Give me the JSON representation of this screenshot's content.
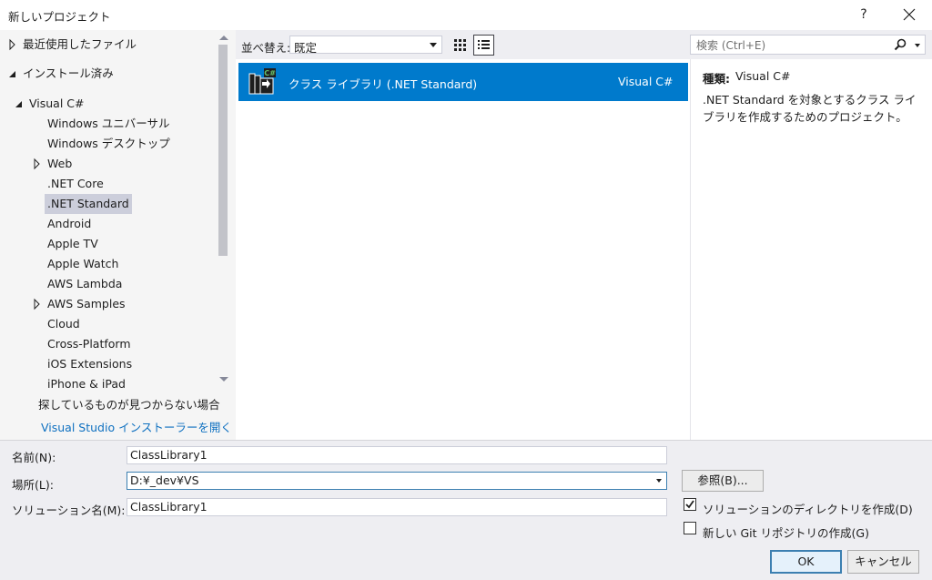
{
  "window": {
    "title": "新しいプロジェクト",
    "help_label": "?"
  },
  "tree": {
    "items": [
      {
        "label": "最近使用したファイル",
        "arrow": "right"
      },
      {
        "label": "インストール済み",
        "arrow": "down"
      },
      {
        "label": "Visual C#",
        "arrow": "down"
      },
      {
        "label": "Windows ユニバーサル",
        "arrow": ""
      },
      {
        "label": "Windows デスクトップ",
        "arrow": ""
      },
      {
        "label": "Web",
        "arrow": "right"
      },
      {
        "label": ".NET Core",
        "arrow": ""
      },
      {
        "label": ".NET Standard",
        "arrow": "",
        "selected": true
      },
      {
        "label": "Android",
        "arrow": ""
      },
      {
        "label": "Apple TV",
        "arrow": ""
      },
      {
        "label": "Apple Watch",
        "arrow": ""
      },
      {
        "label": "AWS Lambda",
        "arrow": ""
      },
      {
        "label": "AWS Samples",
        "arrow": "right"
      },
      {
        "label": "Cloud",
        "arrow": ""
      },
      {
        "label": "Cross-Platform",
        "arrow": ""
      },
      {
        "label": "iOS Extensions",
        "arrow": ""
      },
      {
        "label": "iPhone & iPad",
        "arrow": ""
      }
    ],
    "not_found_text": "探しているものが見つからない場合",
    "installer_link": "Visual Studio インストーラーを開く"
  },
  "toolbar": {
    "sort_label": "並べ替え:",
    "sort_value": "既定"
  },
  "search": {
    "placeholder": "検索 (Ctrl+E)"
  },
  "templates": [
    {
      "name": "クラス ライブラリ (.NET Standard)",
      "language": "Visual C#",
      "icon": "class-library-csharp-icon",
      "icon_badge": "C#"
    }
  ],
  "details": {
    "type_label": "種類:",
    "type_value": "Visual C#",
    "description": ".NET Standard を対象とするクラス ライブラリを作成するためのプロジェクト。"
  },
  "form": {
    "name_label": "名前(N):",
    "name_value": "ClassLibrary1",
    "location_label": "場所(L):",
    "location_value": "D:¥_dev¥VS",
    "solution_label": "ソリューション名(M):",
    "solution_value": "ClassLibrary1",
    "browse_label": "参照(B)...",
    "create_dir_label": "ソリューションのディレクトリを作成(D)",
    "create_dir_checked": true,
    "git_label": "新しい Git リポジトリの作成(G)",
    "git_checked": false,
    "ok_label": "OK",
    "cancel_label": "キャンセル"
  },
  "colors": {
    "accent": "#007acc",
    "link": "#0e70c0",
    "selection": "#cccedb"
  }
}
